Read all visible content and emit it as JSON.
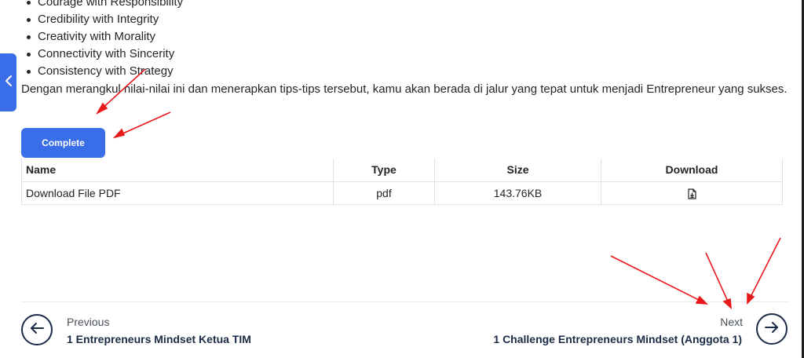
{
  "content": {
    "values_list": [
      "Courage with Responsibility",
      "Credibility with Integrity",
      "Creativity with Morality",
      "Connectivity with Sincerity",
      "Consistency with Strategy"
    ],
    "closing_paragraph": "Dengan merangkul nilai-nilai ini dan menerapkan tips-tips tersebut, kamu akan berada di jalur yang tepat untuk menjadi Entrepreneur yang sukses."
  },
  "sidebar_toggle": {
    "icon": "chevron-left-icon"
  },
  "complete_button": {
    "label": "Complete"
  },
  "files_table": {
    "headers": {
      "name": "Name",
      "type": "Type",
      "size": "Size",
      "download": "Download"
    },
    "rows": [
      {
        "name": "Download File PDF",
        "type": "pdf",
        "size": "143.76KB",
        "download_icon": "file-download-icon"
      }
    ]
  },
  "navigation": {
    "previous": {
      "label": "Previous",
      "title": "1 Entrepreneurs Mindset Ketua TIM",
      "icon": "arrow-left-icon"
    },
    "next": {
      "label": "Next",
      "title": "1 Challenge Entrepreneurs Mindset (Anggota 1)",
      "icon": "arrow-right-icon"
    }
  },
  "colors": {
    "accent": "#3a6ee8",
    "annotation_arrows": "#e8191b",
    "nav_dark": "#1c2b46"
  }
}
